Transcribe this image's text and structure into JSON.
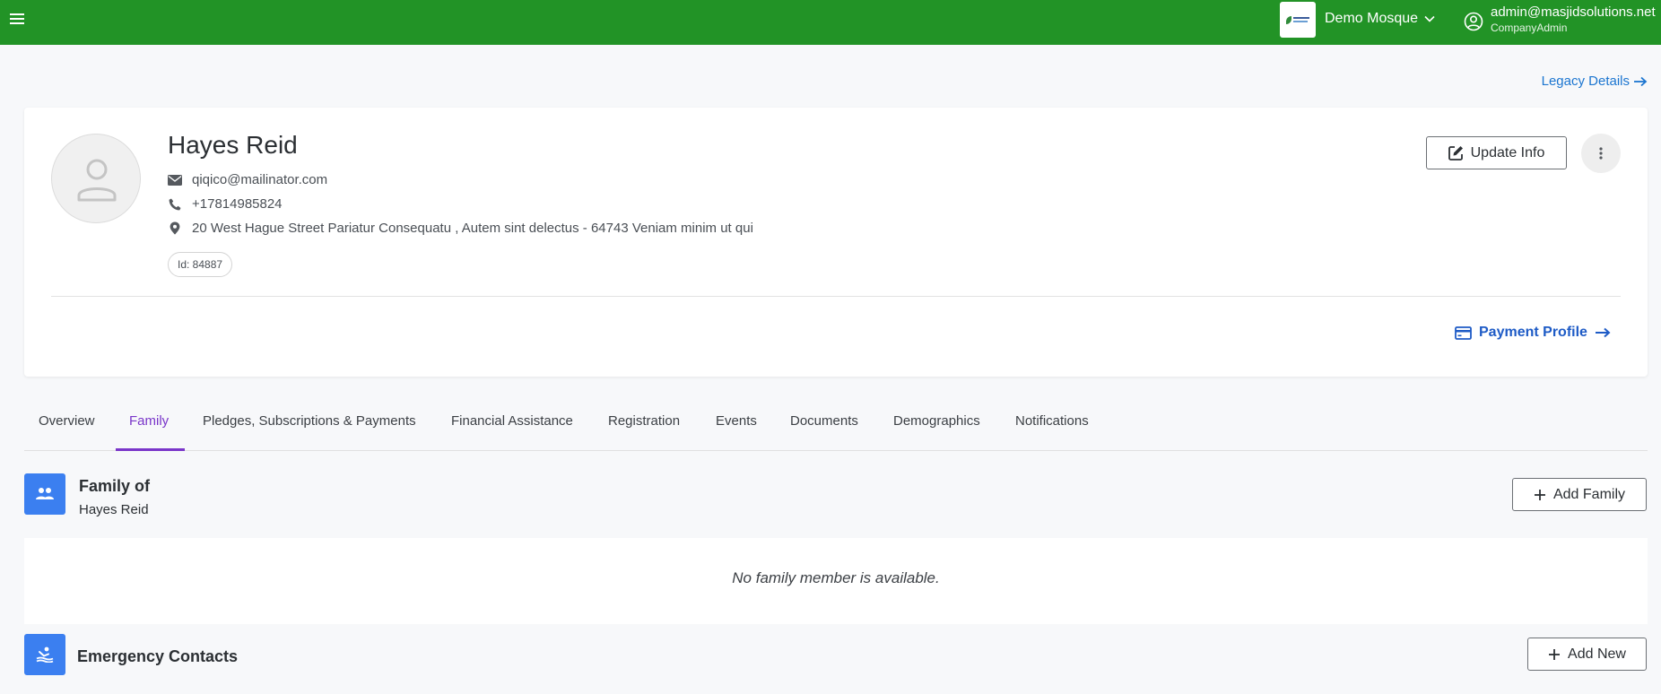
{
  "topbar": {
    "org_name": "Demo Mosque",
    "user_email": "admin@masjidsolutions.net",
    "user_role": "CompanyAdmin"
  },
  "legacy_link": "Legacy Details",
  "profile": {
    "name": "Hayes Reid",
    "email": "qiqico@mailinator.com",
    "phone": "+17814985824",
    "address": "20 West Hague Street Pariatur Consequatu , Autem sint delectus - 64743 Veniam minim ut qui",
    "id_label": "Id: 84887",
    "update_button": "Update Info",
    "payment_profile": "Payment Profile"
  },
  "tabs": [
    {
      "label": "Overview"
    },
    {
      "label": "Family"
    },
    {
      "label": "Pledges, Subscriptions & Payments"
    },
    {
      "label": "Financial Assistance"
    },
    {
      "label": "Registration"
    },
    {
      "label": "Events"
    },
    {
      "label": "Documents"
    },
    {
      "label": "Demographics"
    },
    {
      "label": "Notifications"
    }
  ],
  "active_tab": "Family",
  "family": {
    "title": "Family of",
    "subtitle": "Hayes Reid",
    "add_button": "Add Family",
    "empty_message": "No family member is available."
  },
  "emergency": {
    "title": "Emergency Contacts",
    "add_button": "Add New"
  },
  "colors": {
    "topbar": "#229326",
    "accent_tab": "#7a36c9",
    "link": "#1b75d0",
    "section_icon": "#3b7ff0"
  }
}
